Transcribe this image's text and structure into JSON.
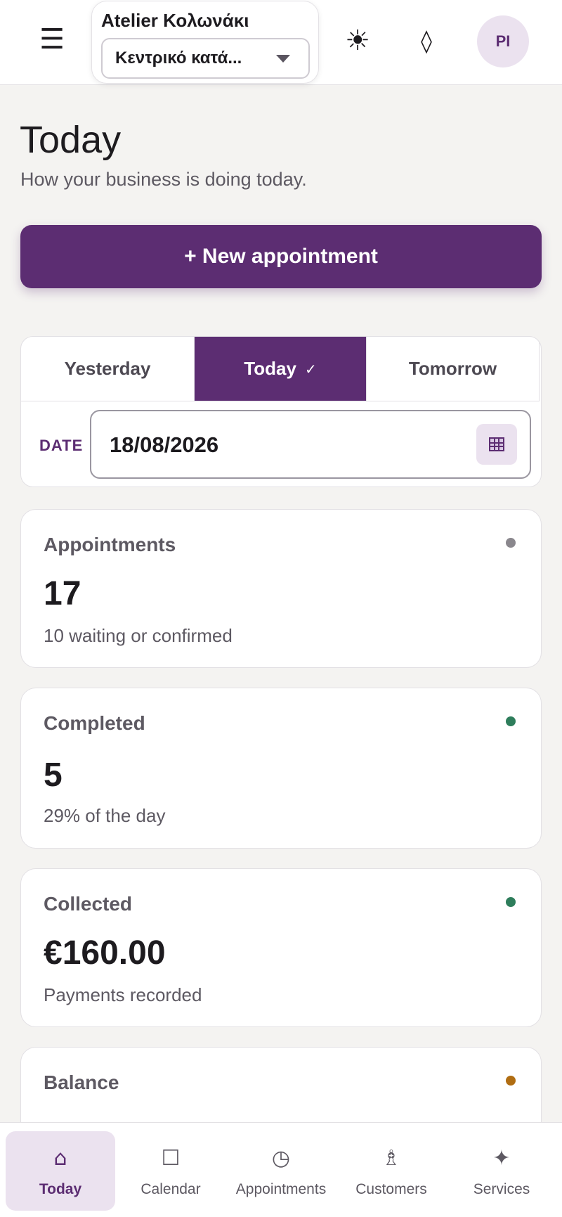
{
  "header": {
    "menu_icon": "☰",
    "org_name": "Atelier Κολωνάκι",
    "location": "Κεντρικό κατά...",
    "theme_icon": "☀",
    "diamond_icon": "◊",
    "avatar_initials": "PI"
  },
  "page": {
    "title": "Today",
    "subtitle": "How your business is doing today."
  },
  "actions": {
    "new_appointment": "+ New appointment"
  },
  "day_switcher": {
    "yesterday": "Yesterday",
    "today": "Today",
    "today_check": "✓",
    "tomorrow": "Tomorrow",
    "selected": "Today",
    "date_label": "DATE",
    "date_value": "18/08/2026"
  },
  "stats": [
    {
      "title": "Appointments",
      "value": "17",
      "sub": "10 waiting or confirmed",
      "dot_color": "#8a878d"
    },
    {
      "title": "Completed",
      "value": "5",
      "sub": "29% of the day",
      "dot_color": "#2e7d5b"
    },
    {
      "title": "Collected",
      "value": "€160.00",
      "sub": "Payments recorded",
      "dot_color": "#2e7d5b"
    },
    {
      "title": "Balance",
      "value": "",
      "sub": "",
      "dot_color": "#b06d12"
    }
  ],
  "colors": {
    "brand": "#5c2d72",
    "brand_light": "#ebe2ef",
    "background": "#f4f3f1"
  },
  "nav": [
    {
      "label": "Today",
      "icon": "⌂",
      "active": true
    },
    {
      "label": "Calendar",
      "icon": "☐",
      "active": false
    },
    {
      "label": "Appointments",
      "icon": "◷",
      "active": false
    },
    {
      "label": "Customers",
      "icon": "♗",
      "active": false
    },
    {
      "label": "Services",
      "icon": "✦",
      "active": false
    }
  ]
}
